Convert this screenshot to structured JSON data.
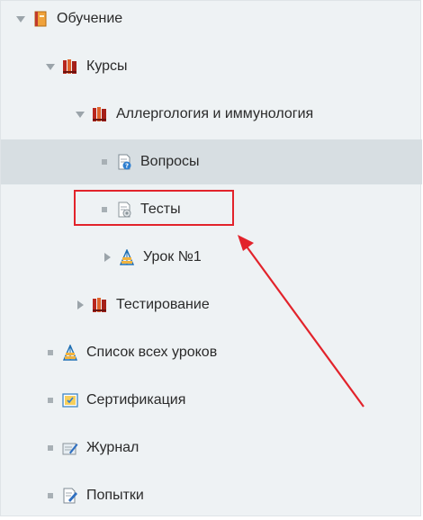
{
  "tree": {
    "items": [
      {
        "label": "Обучение",
        "control": "expanded",
        "icon": "book-icon"
      },
      {
        "label": "Курсы",
        "control": "expanded",
        "icon": "books-icon"
      },
      {
        "label": "Аллергология и иммунология",
        "control": "expanded",
        "icon": "books-icon"
      },
      {
        "label": "Вопросы",
        "control": "bullet",
        "icon": "questions-icon",
        "selected": true
      },
      {
        "label": "Тесты",
        "control": "bullet",
        "icon": "tests-icon"
      },
      {
        "label": "Урок №1",
        "control": "collapsed",
        "icon": "lesson-icon"
      },
      {
        "label": "Тестирование",
        "control": "collapsed",
        "icon": "books-icon"
      },
      {
        "label": "Список всех уроков",
        "control": "bullet",
        "icon": "lesson-icon"
      },
      {
        "label": "Сертификация",
        "control": "bullet",
        "icon": "certificate-icon"
      },
      {
        "label": "Журнал",
        "control": "bullet",
        "icon": "journal-icon"
      },
      {
        "label": "Попытки",
        "control": "bullet",
        "icon": "attempts-icon"
      }
    ]
  },
  "colors": {
    "panel_bg": "#eef2f4",
    "selected_bg": "#d7dee2",
    "annotation_red": "#e2232b"
  }
}
